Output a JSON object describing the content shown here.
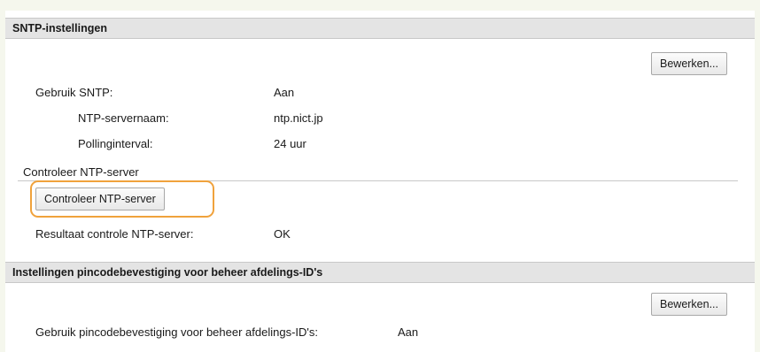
{
  "sntp": {
    "title": "SNTP-instellingen",
    "edit_label": "Bewerken...",
    "use_sntp_label": "Gebruik SNTP:",
    "use_sntp_value": "Aan",
    "ntp_server_label": "NTP-servernaam:",
    "ntp_server_value": "ntp.nict.jp",
    "polling_label": "Pollinginterval:",
    "polling_value": "24 uur",
    "check_header": "Controleer NTP-server",
    "check_button_label": "Controleer NTP-server",
    "result_label": "Resultaat controle NTP-server:",
    "result_value": "OK"
  },
  "pin": {
    "title": "Instellingen pincodebevestiging voor beheer afdelings-ID's",
    "edit_label": "Bewerken...",
    "use_pin_label": "Gebruik pincodebevestiging voor beheer afdelings-ID's:",
    "use_pin_value": "Aan"
  },
  "colors": {
    "highlight": "#f0a23c",
    "header_bg": "#e4e4e4",
    "page_bg": "#f5f7ed"
  }
}
